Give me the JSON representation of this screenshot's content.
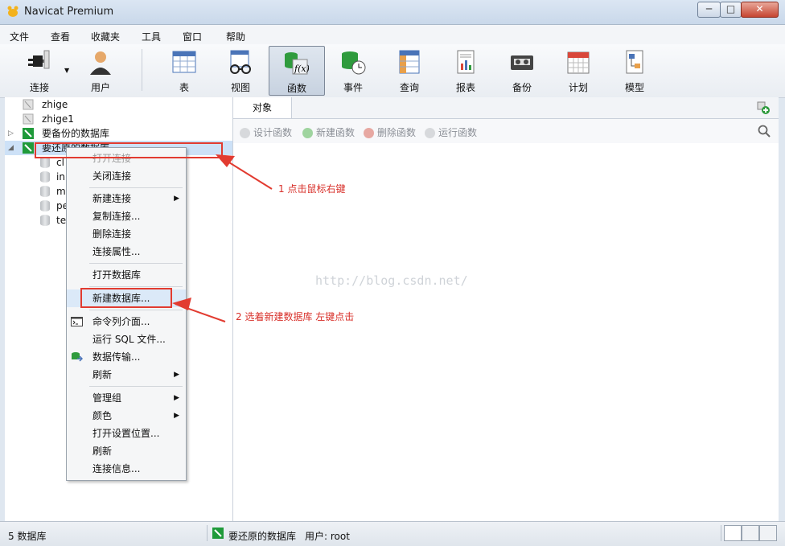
{
  "window": {
    "title": "Navicat Premium",
    "min": "─",
    "max": "□",
    "close": "✕"
  },
  "menubar": [
    "文件",
    "查看",
    "收藏夹",
    "工具",
    "窗口",
    "帮助"
  ],
  "toolbar": [
    {
      "label": "连接",
      "icon": "plug-icon"
    },
    {
      "label": "用户",
      "icon": "user-icon"
    },
    {
      "label": "表",
      "icon": "table-icon"
    },
    {
      "label": "视图",
      "icon": "view-glasses-icon"
    },
    {
      "label": "函数",
      "icon": "function-icon",
      "active": true
    },
    {
      "label": "事件",
      "icon": "event-clock-icon"
    },
    {
      "label": "查询",
      "icon": "query-icon"
    },
    {
      "label": "报表",
      "icon": "report-icon"
    },
    {
      "label": "备份",
      "icon": "backup-tape-icon"
    },
    {
      "label": "计划",
      "icon": "calendar-icon"
    },
    {
      "label": "模型",
      "icon": "model-icon"
    }
  ],
  "tree": {
    "connections": [
      {
        "name": "zhige",
        "icon": "connection-icon"
      },
      {
        "name": "zhige1",
        "icon": "connection-icon"
      },
      {
        "name": "要备份的数据库",
        "icon": "mysql-connection-icon",
        "expander": "▷"
      },
      {
        "name": "要还原的数据库",
        "icon": "mysql-connection-icon",
        "expander": "◢"
      }
    ],
    "databases": [
      "cl",
      "in",
      "m",
      "pe",
      "te"
    ]
  },
  "context_menu": {
    "items": [
      {
        "label": "打开连接",
        "disabled": true
      },
      {
        "label": "关闭连接"
      },
      {
        "label": "新建连接",
        "submenu": true
      },
      {
        "label": "复制连接..."
      },
      {
        "label": "删除连接"
      },
      {
        "label": "连接属性..."
      },
      {
        "label": "打开数据库"
      },
      {
        "label": "新建数据库..."
      },
      {
        "label": "命令列介面...",
        "icon": "console-icon"
      },
      {
        "label": "运行 SQL 文件..."
      },
      {
        "label": "数据传输...",
        "icon": "data-transfer-icon"
      },
      {
        "label": "刷新",
        "submenu": true
      },
      {
        "label": "管理组",
        "submenu": true
      },
      {
        "label": "颜色",
        "submenu": true
      },
      {
        "label": "打开设置位置..."
      },
      {
        "label": "刷新"
      },
      {
        "label": "连接信息..."
      }
    ]
  },
  "object_pane": {
    "tab": "对象",
    "actions": [
      "设计函数",
      "新建函数",
      "删除函数",
      "运行函数"
    ]
  },
  "watermark": "http://blog.csdn.net/",
  "annotations": {
    "step1": "1 点击鼠标右键",
    "step2": "2 选着新建数据库 左键点击"
  },
  "statusbar": {
    "count": "5 数据库",
    "connection": "要还原的数据库",
    "user": "用户: root"
  },
  "colors": {
    "accent_red": "#e23b30",
    "mysql_green": "#1f9a3a",
    "title_bar": "#c9d8ea"
  }
}
